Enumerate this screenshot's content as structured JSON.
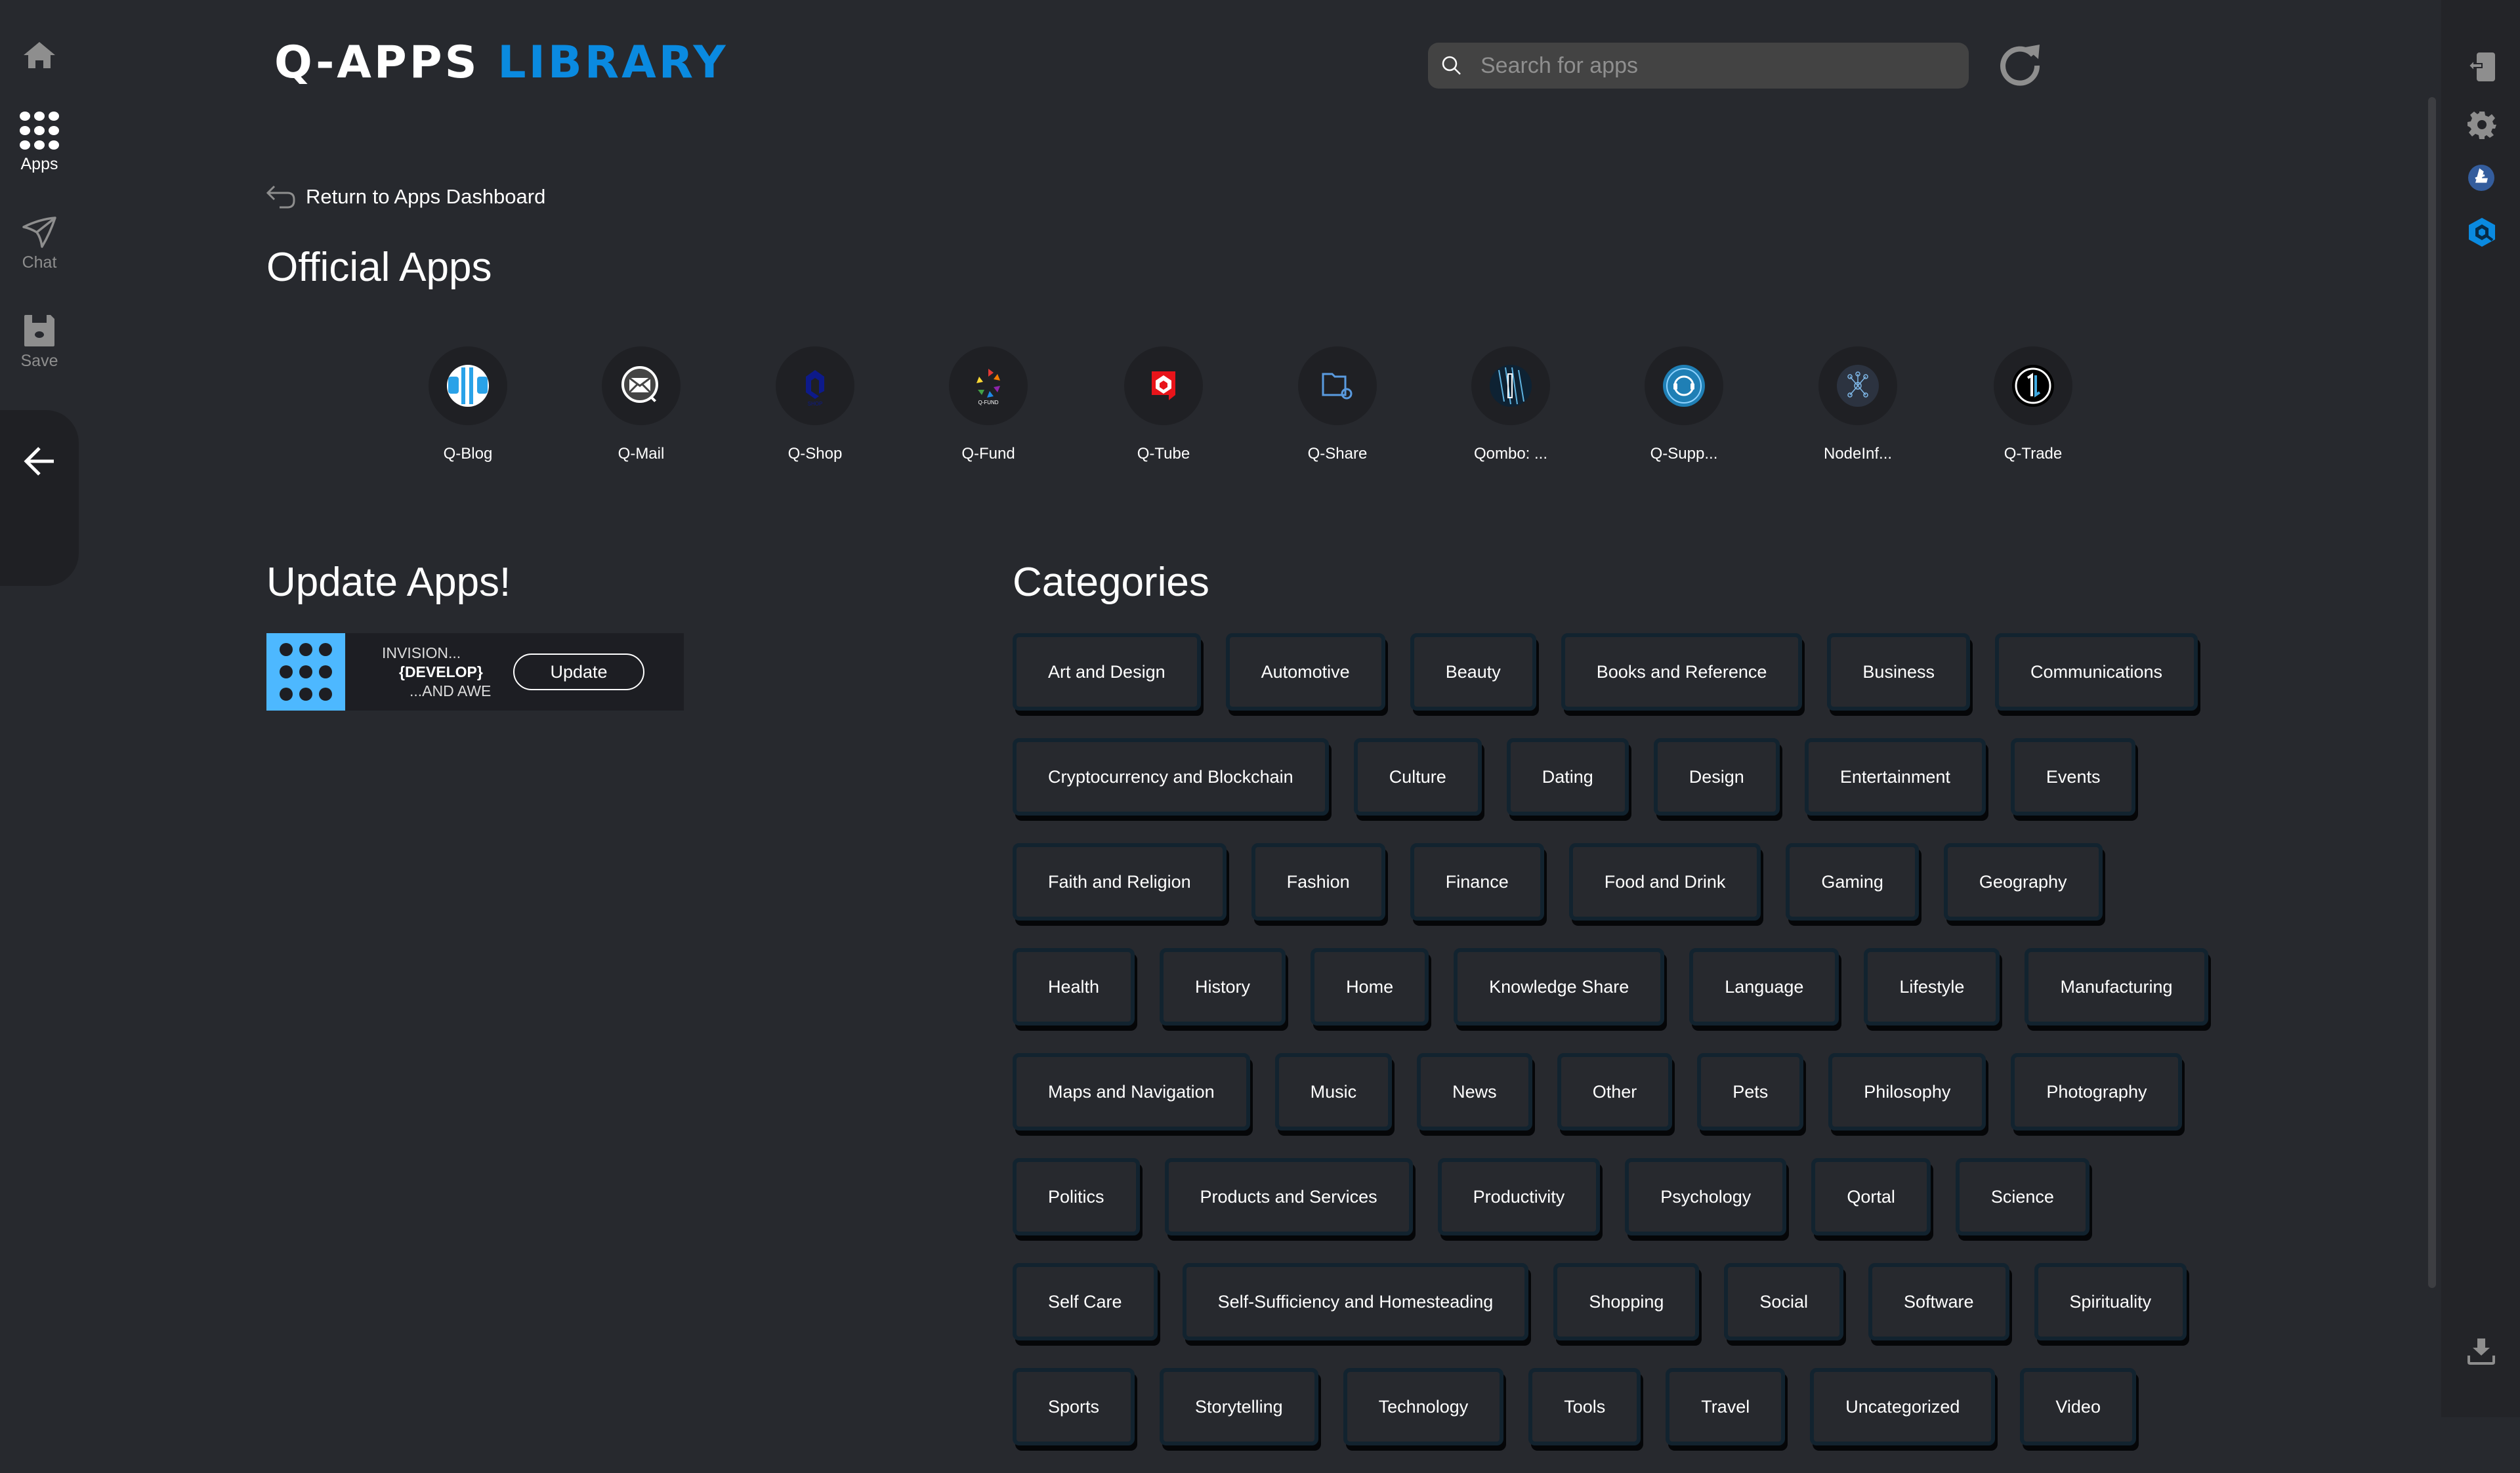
{
  "left_nav": {
    "items": [
      {
        "label": "",
        "icon": "home-icon"
      },
      {
        "label": "Apps",
        "icon": "apps-grid-icon",
        "active": true
      },
      {
        "label": "Chat",
        "icon": "send-icon"
      },
      {
        "label": "Save",
        "icon": "save-icon"
      }
    ],
    "back_icon": "arrow-left-icon"
  },
  "header": {
    "title_part1": "Q-APPS",
    "title_part2": "LIBRARY",
    "accent_color": "#0a8ae0",
    "search_placeholder": "Search for apps",
    "search_value": "",
    "refresh_icon": "refresh-icon"
  },
  "return_link": "Return to Apps Dashboard",
  "official_apps": {
    "title": "Official Apps",
    "apps": [
      {
        "label": "Q-Blog"
      },
      {
        "label": "Q-Mail"
      },
      {
        "label": "Q-Shop"
      },
      {
        "label": "Q-Fund"
      },
      {
        "label": "Q-Tube"
      },
      {
        "label": "Q-Share"
      },
      {
        "label": "Qombo: ..."
      },
      {
        "label": "Q-Supp..."
      },
      {
        "label": "NodeInf..."
      },
      {
        "label": "Q-Trade"
      }
    ]
  },
  "update_apps": {
    "title": "Update Apps!",
    "card": {
      "line1": "INVISION...",
      "line2": "{DEVELOP}",
      "line3": "...AND AWE",
      "button": "Update"
    }
  },
  "categories": {
    "title": "Categories",
    "rows": [
      [
        "Art and Design",
        "Automotive",
        "Beauty",
        "Books and Reference",
        "Business",
        "Communications"
      ],
      [
        "Cryptocurrency and Blockchain",
        "Culture",
        "Dating",
        "Design",
        "Entertainment",
        "Events"
      ],
      [
        "Faith and Religion",
        "Fashion",
        "Finance",
        "Food and Drink",
        "Gaming",
        "Geography"
      ],
      [
        "Health",
        "History",
        "Home",
        "Knowledge Share",
        "Language",
        "Lifestyle",
        "Manufacturing"
      ],
      [
        "Maps and Navigation",
        "Music",
        "News",
        "Other",
        "Pets",
        "Philosophy",
        "Photography"
      ],
      [
        "Politics",
        "Products and Services",
        "Productivity",
        "Psychology",
        "Qortal",
        "Science"
      ],
      [
        "Self Care",
        "Self-Sufficiency and Homesteading",
        "Shopping",
        "Social",
        "Software",
        "Spirituality"
      ],
      [
        "Sports",
        "Storytelling",
        "Technology",
        "Tools",
        "Travel",
        "Uncategorized",
        "Video"
      ]
    ]
  },
  "right_nav": {
    "icons": [
      "logout-icon",
      "settings-icon",
      "litecoin-icon",
      "qortal-icon",
      "download-icon"
    ]
  }
}
